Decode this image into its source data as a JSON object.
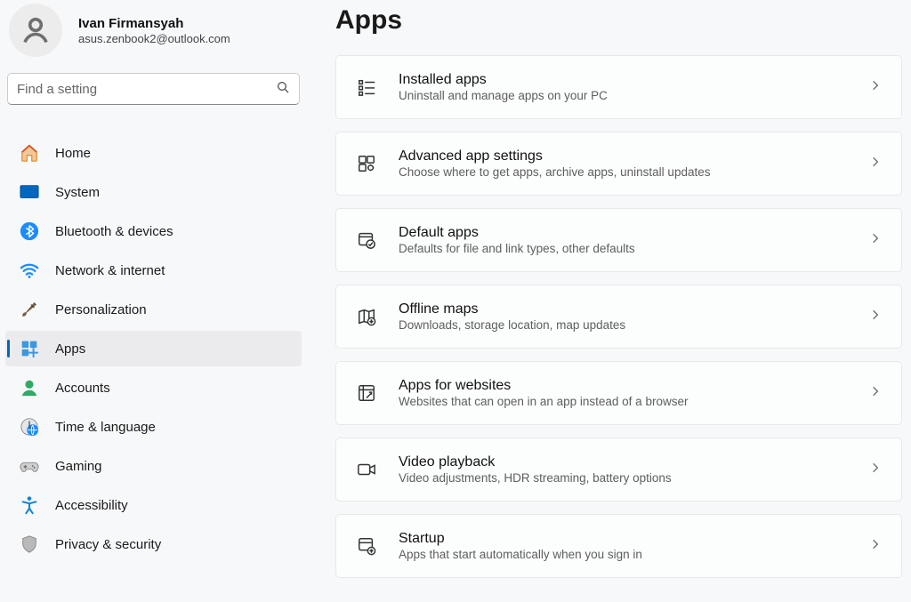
{
  "profile": {
    "name": "Ivan Firmansyah",
    "email": "asus.zenbook2@outlook.com"
  },
  "search": {
    "placeholder": "Find a setting"
  },
  "nav": {
    "items": [
      {
        "label": "Home",
        "icon": "home-icon"
      },
      {
        "label": "System",
        "icon": "system-icon"
      },
      {
        "label": "Bluetooth & devices",
        "icon": "bluetooth-icon"
      },
      {
        "label": "Network & internet",
        "icon": "wifi-icon"
      },
      {
        "label": "Personalization",
        "icon": "brush-icon"
      },
      {
        "label": "Apps",
        "icon": "apps-icon",
        "active": true
      },
      {
        "label": "Accounts",
        "icon": "accounts-icon"
      },
      {
        "label": "Time & language",
        "icon": "clock-globe-icon"
      },
      {
        "label": "Gaming",
        "icon": "gamepad-icon"
      },
      {
        "label": "Accessibility",
        "icon": "accessibility-icon"
      },
      {
        "label": "Privacy & security",
        "icon": "shield-icon"
      }
    ]
  },
  "page": {
    "title": "Apps",
    "cards": [
      {
        "title": "Installed apps",
        "subtitle": "Uninstall and manage apps on your PC",
        "icon": "installed-apps-icon"
      },
      {
        "title": "Advanced app settings",
        "subtitle": "Choose where to get apps, archive apps, uninstall updates",
        "icon": "advanced-settings-icon"
      },
      {
        "title": "Default apps",
        "subtitle": "Defaults for file and link types, other defaults",
        "icon": "default-apps-icon"
      },
      {
        "title": "Offline maps",
        "subtitle": "Downloads, storage location, map updates",
        "icon": "maps-icon"
      },
      {
        "title": "Apps for websites",
        "subtitle": "Websites that can open in an app instead of a browser",
        "icon": "websites-icon"
      },
      {
        "title": "Video playback",
        "subtitle": "Video adjustments, HDR streaming, battery options",
        "icon": "video-icon"
      },
      {
        "title": "Startup",
        "subtitle": "Apps that start automatically when you sign in",
        "icon": "startup-icon"
      }
    ]
  }
}
